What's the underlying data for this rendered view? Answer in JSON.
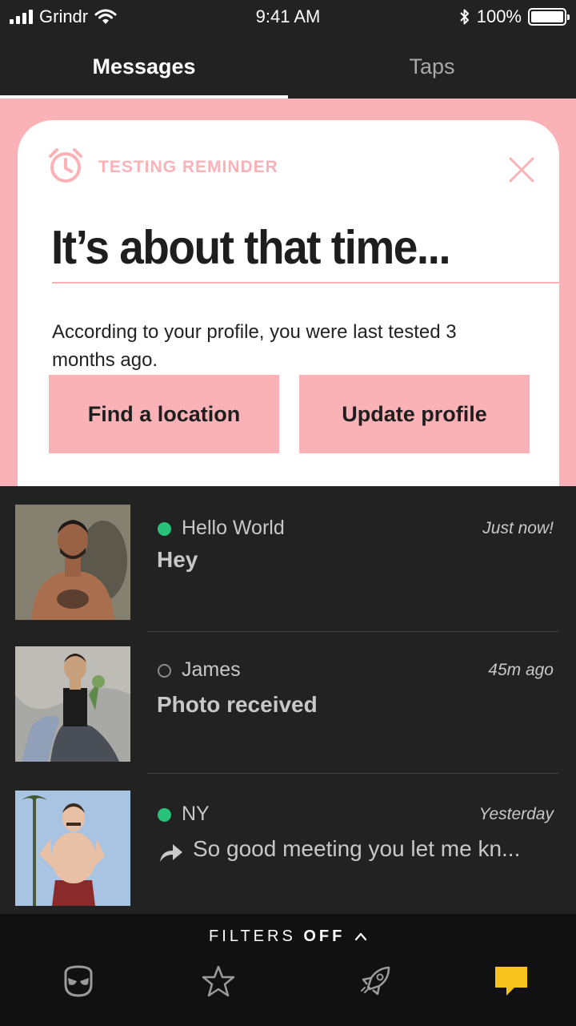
{
  "status_bar": {
    "carrier": "Grindr",
    "time": "9:41 AM",
    "battery": "100%"
  },
  "tabs": [
    {
      "label": "Messages",
      "active": true
    },
    {
      "label": "Taps",
      "active": false
    }
  ],
  "reminder": {
    "label": "TESTING REMINDER",
    "title": "It’s about that time...",
    "body": "According to your profile, you were last tested 3 months ago.",
    "primary_button": "Find a location",
    "secondary_button": "Update profile"
  },
  "messages": [
    {
      "name": "Hello World",
      "time": "Just now!",
      "preview": "Hey",
      "online": true,
      "forwarded": false
    },
    {
      "name": "James",
      "time": "45m ago",
      "preview": "Photo received",
      "online": false,
      "forwarded": false
    },
    {
      "name": "NY",
      "time": "Yesterday",
      "preview": "So good meeting you let me kn...",
      "online": true,
      "forwarded": true
    }
  ],
  "filters": {
    "label": "FILTERS",
    "state": "OFF"
  },
  "nav": [
    {
      "icon": "grindr-mask-icon"
    },
    {
      "icon": "star-icon"
    },
    {
      "icon": "rocket-icon"
    },
    {
      "icon": "chat-bubble-icon",
      "active": true
    }
  ],
  "colors": {
    "accent_pink": "#fbb2b7",
    "online_green": "#28c27a",
    "active_chat": "#f8c21c",
    "background": "#222222"
  }
}
